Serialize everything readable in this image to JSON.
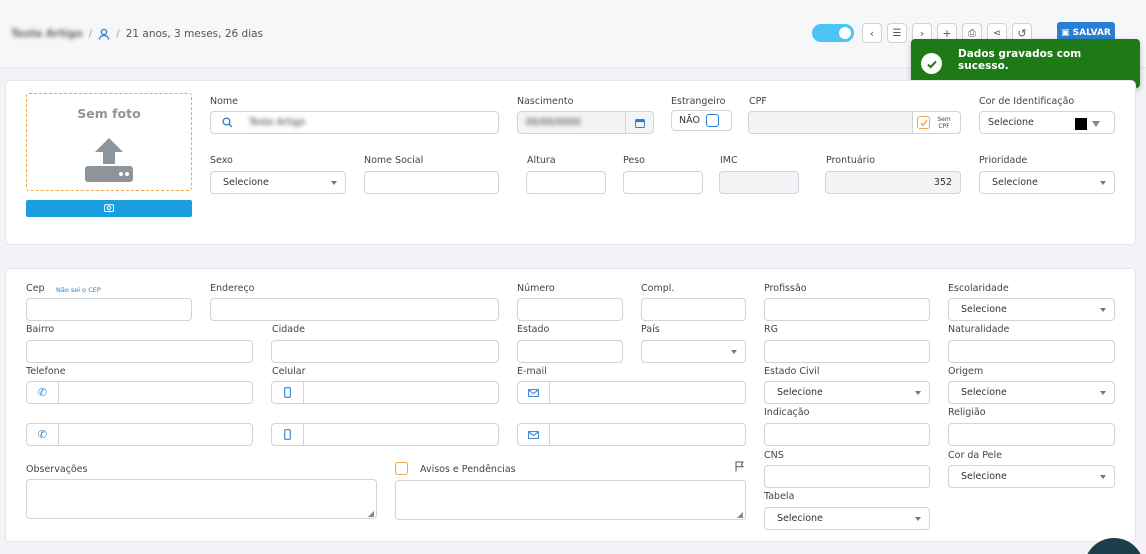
{
  "breadcrumb": {
    "patient_name": "Teste Artigo",
    "separator": "/",
    "age": "21 anos, 3 meses, 26 dias"
  },
  "toolbar": {
    "save_label": "SALVAR"
  },
  "toast": {
    "message": "Dados gravados com sucesso."
  },
  "photo": {
    "label": "Sem foto"
  },
  "patient": {
    "nome_label": "Nome",
    "nome_value": "Teste Artigo",
    "nascimento_label": "Nascimento",
    "nascimento_value": "00/00/0000",
    "estrangeiro_label": "Estrangeiro",
    "estrangeiro_value": "NÃO",
    "cpf_label": "CPF",
    "sem_cpf_label": "Sem CPF",
    "cor_label": "Cor de Identificação",
    "cor_value": "Selecione",
    "sexo_label": "Sexo",
    "sexo_value": "Selecione",
    "nome_social_label": "Nome Social",
    "altura_label": "Altura",
    "peso_label": "Peso",
    "imc_label": "IMC",
    "prontuario_label": "Prontuário",
    "prontuario_value": "352",
    "prioridade_label": "Prioridade",
    "prioridade_value": "Selecione"
  },
  "address": {
    "cep_label": "Cep",
    "cep_link": "Não sei o CEP",
    "endereco_label": "Endereço",
    "numero_label": "Número",
    "compl_label": "Compl.",
    "profissao_label": "Profissão",
    "escolaridade_label": "Escolaridade",
    "escolaridade_value": "Selecione",
    "bairro_label": "Bairro",
    "cidade_label": "Cidade",
    "estado_label": "Estado",
    "pais_label": "País",
    "rg_label": "RG",
    "naturalidade_label": "Naturalidade",
    "telefone_label": "Telefone",
    "celular_label": "Celular",
    "email_label": "E-mail",
    "estado_civil_label": "Estado Civil",
    "estado_civil_value": "Selecione",
    "origem_label": "Origem",
    "origem_value": "Selecione",
    "indicacao_label": "Indicação",
    "religiao_label": "Religião",
    "cns_label": "CNS",
    "cor_pele_label": "Cor da Pele",
    "cor_pele_value": "Selecione",
    "observacoes_label": "Observações",
    "avisos_label": "Avisos e Pendências",
    "tabela_label": "Tabela",
    "tabela_value": "Selecione"
  },
  "colors": {
    "accent": "#2a7fd4",
    "toast": "#1e7a16",
    "photo_border": "#f0a64b",
    "cam_button": "#1a9ee0",
    "toggle": "#4cc3f5"
  }
}
